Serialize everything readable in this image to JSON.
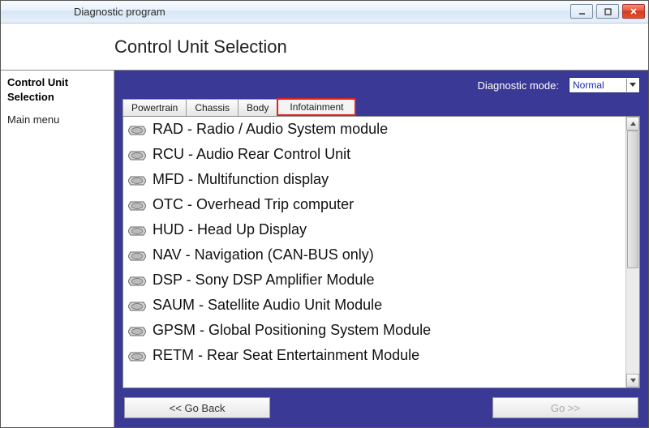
{
  "window": {
    "title": "Diagnostic program"
  },
  "header": {
    "title": "Control Unit Selection"
  },
  "sidebar": {
    "heading1": "Control Unit",
    "heading2": "Selection",
    "menu": "Main menu"
  },
  "mode": {
    "label": "Diagnostic mode:",
    "value": "Normal"
  },
  "tabs": [
    {
      "label": "Powertrain",
      "selected": false
    },
    {
      "label": "Chassis",
      "selected": false
    },
    {
      "label": "Body",
      "selected": false
    },
    {
      "label": "Infotainment",
      "selected": true
    }
  ],
  "modules": [
    {
      "label": "RAD - Radio / Audio System module"
    },
    {
      "label": "RCU - Audio Rear Control Unit"
    },
    {
      "label": "MFD - Multifunction display"
    },
    {
      "label": "OTC - Overhead Trip computer"
    },
    {
      "label": "HUD - Head Up Display"
    },
    {
      "label": "NAV - Navigation (CAN-BUS only)"
    },
    {
      "label": "DSP - Sony DSP Amplifier Module"
    },
    {
      "label": "SAUM - Satellite Audio Unit Module"
    },
    {
      "label": "GPSM - Global Positioning System Module"
    },
    {
      "label": "RETM - Rear Seat Entertainment Module"
    }
  ],
  "buttons": {
    "back": "<< Go Back",
    "go": "Go >>"
  }
}
